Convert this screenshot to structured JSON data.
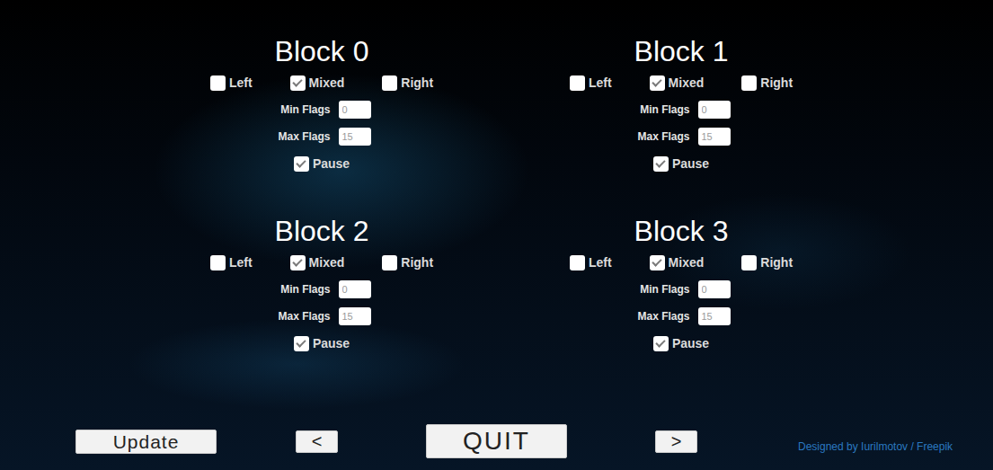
{
  "blocks": [
    {
      "title": "Block 0",
      "modes": [
        {
          "label": "Left",
          "checked": false
        },
        {
          "label": "Mixed",
          "checked": true
        },
        {
          "label": "Right",
          "checked": false
        }
      ],
      "min_flags": {
        "label": "Min Flags",
        "value": "0"
      },
      "max_flags": {
        "label": "Max Flags",
        "value": "15"
      },
      "pause": {
        "label": "Pause",
        "checked": true
      }
    },
    {
      "title": "Block 1",
      "modes": [
        {
          "label": "Left",
          "checked": false
        },
        {
          "label": "Mixed",
          "checked": true
        },
        {
          "label": "Right",
          "checked": false
        }
      ],
      "min_flags": {
        "label": "Min Flags",
        "value": "0"
      },
      "max_flags": {
        "label": "Max Flags",
        "value": "15"
      },
      "pause": {
        "label": "Pause",
        "checked": true
      }
    },
    {
      "title": "Block 2",
      "modes": [
        {
          "label": "Left",
          "checked": false
        },
        {
          "label": "Mixed",
          "checked": true
        },
        {
          "label": "Right",
          "checked": false
        }
      ],
      "min_flags": {
        "label": "Min Flags",
        "value": "0"
      },
      "max_flags": {
        "label": "Max Flags",
        "value": "15"
      },
      "pause": {
        "label": "Pause",
        "checked": true
      }
    },
    {
      "title": "Block 3",
      "modes": [
        {
          "label": "Left",
          "checked": false
        },
        {
          "label": "Mixed",
          "checked": true
        },
        {
          "label": "Right",
          "checked": false
        }
      ],
      "min_flags": {
        "label": "Min Flags",
        "value": "0"
      },
      "max_flags": {
        "label": "Max Flags",
        "value": "15"
      },
      "pause": {
        "label": "Pause",
        "checked": true
      }
    }
  ],
  "buttons": {
    "update": "Update",
    "prev": "<",
    "quit": "QUIT",
    "next": ">"
  },
  "credit": "Designed by Iurilmotov / Freepik"
}
